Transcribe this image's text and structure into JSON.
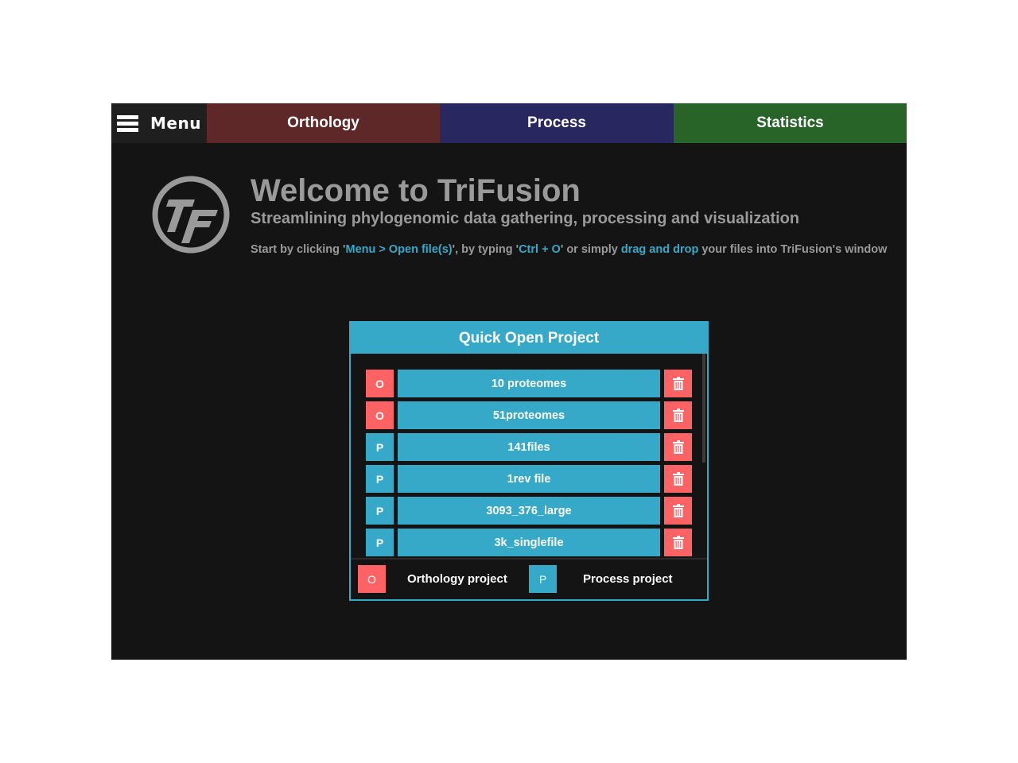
{
  "colors": {
    "app_background": "#141414",
    "menu_background": "#1f1f1f",
    "orthology": "#5f2828",
    "process": "#29275f",
    "statistics": "#286428",
    "accent": "#37a9c8",
    "orthology_badge": "#fd6265",
    "delete": "#fd6265",
    "muted_text": "#9a9a9a"
  },
  "topbar": {
    "menu_icon": "hamburger-icon",
    "menu_label": "Menu",
    "tabs": [
      {
        "label": "Orthology",
        "color": "#5f2828"
      },
      {
        "label": "Process",
        "color": "#29275f"
      },
      {
        "label": "Statistics",
        "color": "#286428"
      }
    ]
  },
  "welcome": {
    "logo_icon": "trifusion-logo-icon",
    "title": "Welcome to TriFusion",
    "subtitle": "Streamlining phylogenomic data gathering, processing and visualization",
    "hint": {
      "part1": "Start by clicking '",
      "menu_path": "Menu > Open file(s)",
      "part2": "', by typing '",
      "shortcut": "Ctrl + O",
      "part3": "' or simply ",
      "drag_drop": "drag and drop",
      "part4": " your files into TriFusion's window"
    }
  },
  "quick_open": {
    "title": "Quick Open Project",
    "delete_icon": "trash-icon",
    "projects": [
      {
        "type": "O",
        "name": "10 proteomes",
        "badge_color": "#fd6265"
      },
      {
        "type": "O",
        "name": "51proteomes",
        "badge_color": "#fd6265"
      },
      {
        "type": "P",
        "name": "141files",
        "badge_color": "#37a9c8"
      },
      {
        "type": "P",
        "name": "1rev file",
        "badge_color": "#37a9c8"
      },
      {
        "type": "P",
        "name": "3093_376_large",
        "badge_color": "#37a9c8"
      },
      {
        "type": "P",
        "name": "3k_singlefile",
        "badge_color": "#37a9c8"
      }
    ],
    "legend": {
      "orthology_badge": "O",
      "orthology_label": "Orthology project",
      "process_badge": "P",
      "process_label": "Process project"
    }
  }
}
